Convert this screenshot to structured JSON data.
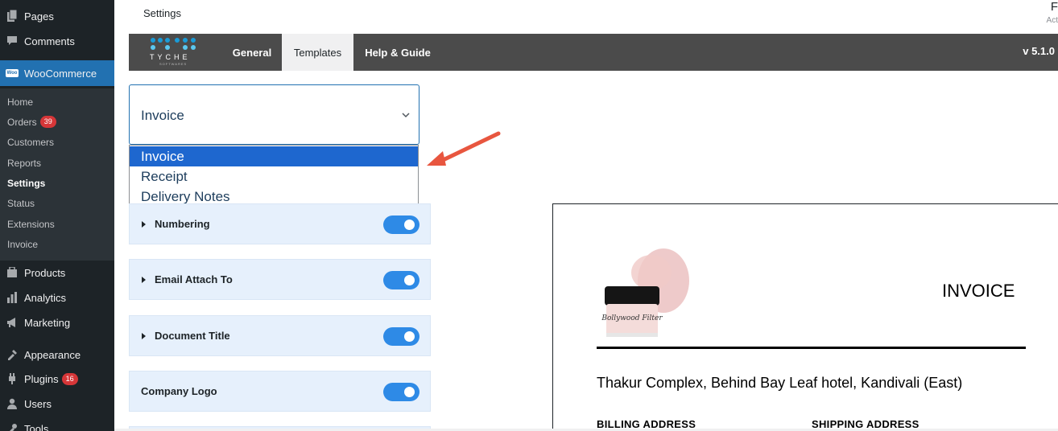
{
  "header": {
    "title": "Settings",
    "edge_top": "F",
    "edge_sub": "Act"
  },
  "sidebar": {
    "items": [
      {
        "label": "Pages",
        "icon": "pages-icon"
      },
      {
        "label": "Comments",
        "icon": "comments-icon"
      },
      {
        "label": "WooCommerce",
        "icon": "woo-icon"
      },
      {
        "label": "Products",
        "icon": "products-icon"
      },
      {
        "label": "Analytics",
        "icon": "analytics-icon"
      },
      {
        "label": "Marketing",
        "icon": "marketing-icon"
      },
      {
        "label": "Appearance",
        "icon": "appearance-icon"
      },
      {
        "label": "Plugins",
        "icon": "plugins-icon",
        "badge": "16"
      },
      {
        "label": "Users",
        "icon": "users-icon"
      },
      {
        "label": "Tools",
        "icon": "tools-icon"
      }
    ],
    "woo_badge_text": "Woo",
    "submenu": [
      {
        "label": "Home"
      },
      {
        "label": "Orders",
        "badge": "39"
      },
      {
        "label": "Customers"
      },
      {
        "label": "Reports"
      },
      {
        "label": "Settings",
        "active": true
      },
      {
        "label": "Status"
      },
      {
        "label": "Extensions"
      },
      {
        "label": "Invoice"
      }
    ]
  },
  "nav": {
    "logo_text": "TYCHE",
    "logo_sub": "SOFTWARES",
    "tabs": [
      {
        "label": "General"
      },
      {
        "label": "Templates",
        "active": true
      },
      {
        "label": "Help & Guide"
      }
    ],
    "version": "v 5.1.0"
  },
  "template_select": {
    "value": "Invoice",
    "options": [
      "Invoice",
      "Receipt",
      "Delivery Notes"
    ],
    "highlighted": "Invoice"
  },
  "settings_rows": [
    {
      "label": "Numbering",
      "expandable": true,
      "enabled": true
    },
    {
      "label": "Email Attach To",
      "expandable": true,
      "enabled": true
    },
    {
      "label": "Document Title",
      "expandable": true,
      "enabled": true
    },
    {
      "label": "Company Logo",
      "expandable": false,
      "enabled": true
    }
  ],
  "preview": {
    "title": "INVOICE",
    "product_label": "Bollywood Filter",
    "address": "Thakur Complex, Behind Bay Leaf hotel, Kandivali (East)",
    "billing_heading": "BILLING ADDRESS",
    "shipping_heading": "SHIPPING ADDRESS"
  },
  "colors": {
    "sidebar_bg": "#1d2327",
    "submenu_bg": "#2c3338",
    "wp_blue": "#2271b1",
    "badge_red": "#d63638",
    "navbar_bg": "#4b4b4b",
    "toggle_on": "#2e8ae6",
    "row_bg": "#e6f0fc",
    "option_selected": "#1e67cf",
    "arrow": "#e8563f"
  }
}
